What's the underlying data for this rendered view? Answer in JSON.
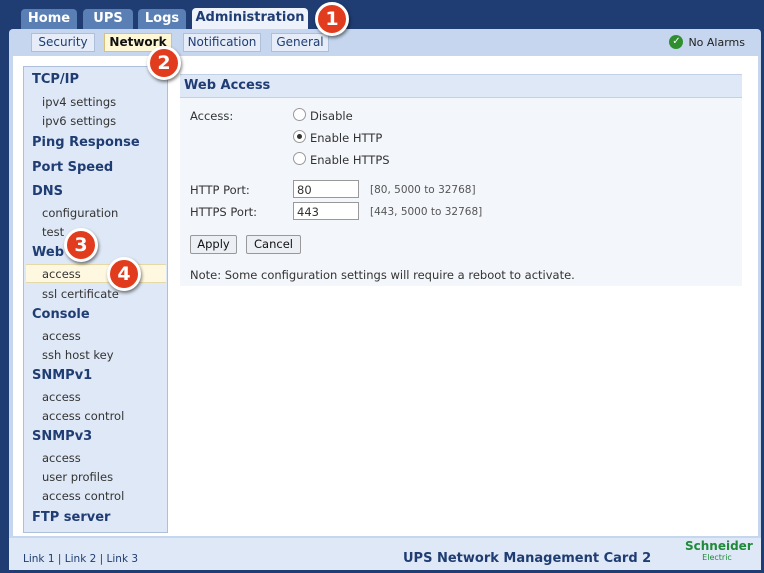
{
  "top_tabs": [
    "Home",
    "UPS",
    "Logs",
    "Administration"
  ],
  "sub_tabs": [
    "Security",
    "Network",
    "Notification",
    "General"
  ],
  "alarm_status": "No Alarms",
  "sidebar": {
    "tcpip": {
      "label": "TCP/IP",
      "items": [
        "ipv4 settings",
        "ipv6 settings"
      ]
    },
    "ping": "Ping Response",
    "port_speed": "Port Speed",
    "dns": {
      "label": "DNS",
      "items": [
        "configuration",
        "test"
      ]
    },
    "web": {
      "label": "Web",
      "items": [
        "access",
        "ssl certificate"
      ]
    },
    "console": {
      "label": "Console",
      "items": [
        "access",
        "ssh host key"
      ]
    },
    "snmpv1": {
      "label": "SNMPv1",
      "items": [
        "access",
        "access control"
      ]
    },
    "snmpv3": {
      "label": "SNMPv3",
      "items": [
        "access",
        "user profiles",
        "access control"
      ]
    },
    "ftp": "FTP server"
  },
  "main": {
    "title": "Web Access",
    "access_label": "Access:",
    "options": [
      "Disable",
      "Enable HTTP",
      "Enable HTTPS"
    ],
    "selected_option": "Enable HTTP",
    "http_port_label": "HTTP Port:",
    "http_port_value": "80",
    "http_port_hint": "[80, 5000 to 32768]",
    "https_port_label": "HTTPS Port:",
    "https_port_value": "443",
    "https_port_hint": "[443, 5000 to 32768]",
    "apply_label": "Apply",
    "cancel_label": "Cancel",
    "note": "Note: Some configuration settings will require a reboot to activate."
  },
  "footer": {
    "links": [
      "Link 1",
      "Link 2",
      "Link 3"
    ],
    "product": "UPS Network Management Card 2",
    "logo": "Schneider",
    "logo_sub": "Electric"
  },
  "callouts": [
    "1",
    "2",
    "3",
    "4"
  ]
}
